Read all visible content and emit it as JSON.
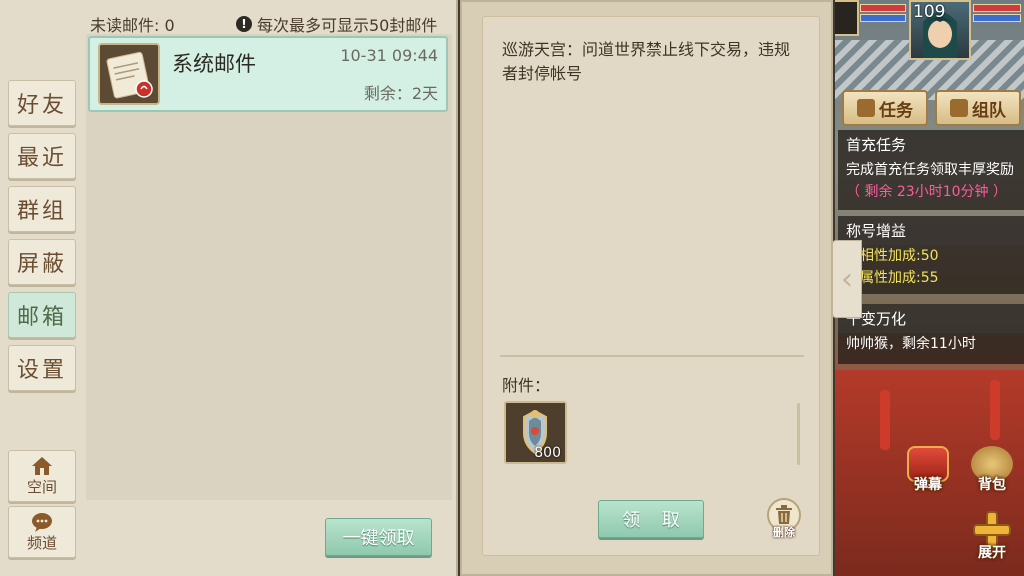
{
  "mail_header": {
    "unread_label": "未读邮件: 0",
    "limit_notice": "每次最多可显示50封邮件"
  },
  "tabs": [
    {
      "label": "好友",
      "active": false
    },
    {
      "label": "最近",
      "active": false
    },
    {
      "label": "群组",
      "active": false
    },
    {
      "label": "屏蔽",
      "active": false
    },
    {
      "label": "邮箱",
      "active": true
    },
    {
      "label": "设置",
      "active": false
    }
  ],
  "bottom_tabs": [
    {
      "label": "空间",
      "icon": "home-icon"
    },
    {
      "label": "频道",
      "icon": "chat-icon"
    }
  ],
  "mails": [
    {
      "title": "系统邮件",
      "date": "10-31 09:44",
      "remaining": "剩余：2天",
      "icon": "letter-icon"
    }
  ],
  "claim_all_label": "一键领取",
  "mail_detail": {
    "body": "巡游天宫：问道世界禁止线下交易，违规者封停帐号",
    "attachment_label": "附件：",
    "attachments": [
      {
        "count": "800",
        "icon": "treasure-icon"
      }
    ],
    "claim_label": "领 取",
    "delete_label": "删除"
  },
  "hud": {
    "player_level": "109",
    "task_button": "任务",
    "team_button": "组队",
    "quests": [
      {
        "title": "首充任务",
        "lines": [
          "完成首充任务领取丰厚奖励",
          "（ 剩余 23小时10分钟 ）"
        ]
      },
      {
        "title": "称号增益",
        "lines": [
          "有相性加成:50",
          "有属性加成:55"
        ]
      },
      {
        "title": "千变万化",
        "lines": [
          "帅帅猴，剩余11小时"
        ]
      }
    ],
    "actions": [
      {
        "label": "弹幕"
      },
      {
        "label": "背包"
      },
      {
        "label": "展开"
      }
    ]
  },
  "colors": {
    "panel_bg": "#e3dccb",
    "active_tab": "#cfe8d9",
    "button_green": "#8fc9ad",
    "text_brown": "#6b4e32",
    "highlight_pink": "#ff5aa3",
    "highlight_yellow": "#f2e35a"
  }
}
